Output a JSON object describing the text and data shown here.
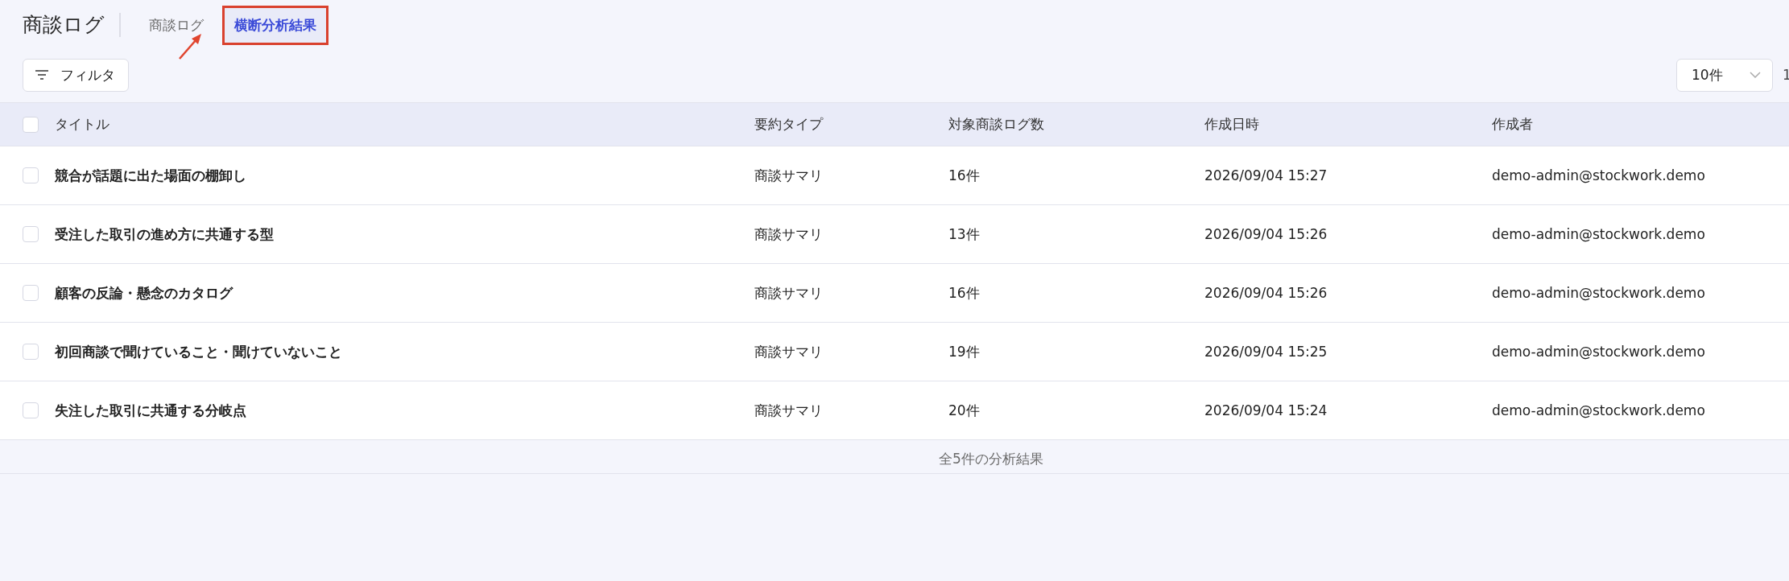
{
  "header": {
    "title": "商談ログ",
    "tabs": [
      {
        "label": "商談ログ",
        "selected": false
      },
      {
        "label": "横断分析結果",
        "selected": true
      }
    ]
  },
  "toolbar": {
    "filter_label": "フィルタ",
    "page_size": "10件",
    "page_indicator": "1"
  },
  "table": {
    "all_checked": false,
    "columns": [
      "タイトル",
      "要約タイプ",
      "対象商談ログ数",
      "作成日時",
      "作成者"
    ],
    "rows": [
      {
        "checked": false,
        "cells": [
          "競合が話題に出た場面の棚卸し",
          "商談サマリ",
          "16件",
          "2026/09/04 15:27",
          "demo-admin@stockwork.demo"
        ]
      },
      {
        "checked": false,
        "cells": [
          "受注した取引の進め方に共通する型",
          "商談サマリ",
          "13件",
          "2026/09/04 15:26",
          "demo-admin@stockwork.demo"
        ]
      },
      {
        "checked": false,
        "cells": [
          "顧客の反論・懸念のカタログ",
          "商談サマリ",
          "16件",
          "2026/09/04 15:26",
          "demo-admin@stockwork.demo"
        ]
      },
      {
        "checked": false,
        "cells": [
          "初回商談で聞けていること・聞けていないこと",
          "商談サマリ",
          "19件",
          "2026/09/04 15:25",
          "demo-admin@stockwork.demo"
        ]
      },
      {
        "checked": false,
        "cells": [
          "失注した取引に共通する分岐点",
          "商談サマリ",
          "20件",
          "2026/09/04 15:24",
          "demo-admin@stockwork.demo"
        ]
      }
    ]
  },
  "footer": {
    "summary": "全5件の分析結果"
  }
}
